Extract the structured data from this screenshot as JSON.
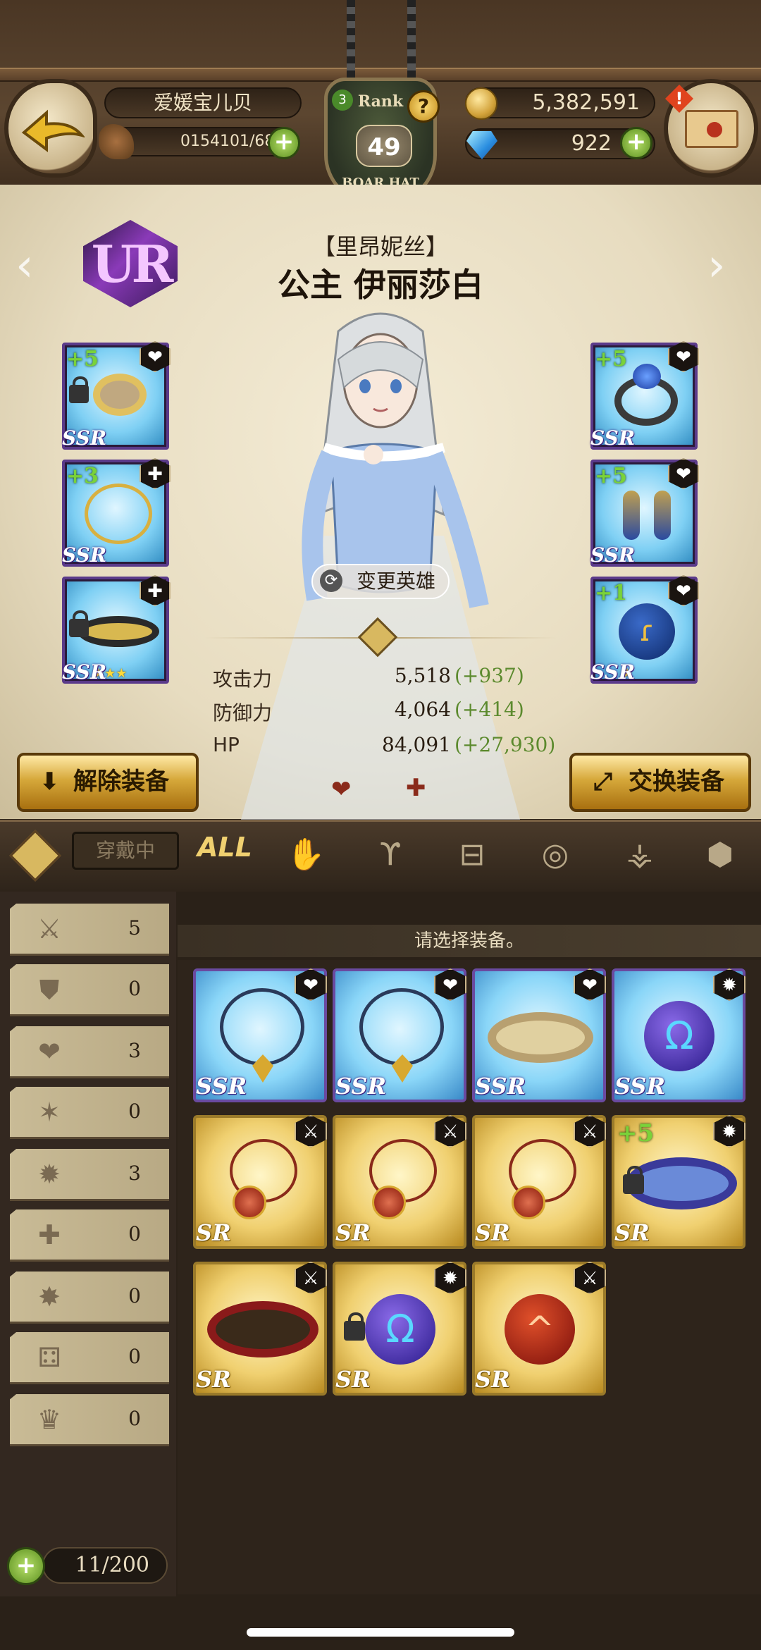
{
  "header": {
    "player_name": "爱媛宝儿贝",
    "stamina": "0154101/68",
    "rank_label": "Rank",
    "rank_level": "49",
    "rank_sub": "BOAR HAT",
    "rank_small": "3",
    "help": "?",
    "gold": "5,382,591",
    "gems": "922",
    "alert": "!"
  },
  "hero": {
    "rarity": "UR",
    "subtitle": "【里昂妮丝】",
    "name": "公主 伊丽莎白",
    "change_hero": "变更英雄"
  },
  "left_slots": [
    {
      "level": "+5",
      "rarity": "SSR",
      "category": "heart-icon",
      "locked": true
    },
    {
      "level": "+3",
      "rarity": "SSR",
      "category": "plus-icon",
      "locked": false
    },
    {
      "level": "",
      "rarity": "SSR",
      "category": "plus-icon",
      "locked": true,
      "stars": "★★★"
    }
  ],
  "right_slots": [
    {
      "level": "+5",
      "rarity": "SSR",
      "category": "heart-icon",
      "locked": false
    },
    {
      "level": "+5",
      "rarity": "SSR",
      "category": "heart-icon",
      "locked": false
    },
    {
      "level": "+1",
      "rarity": "SSR",
      "category": "heart-icon",
      "locked": false,
      "stars": "★"
    }
  ],
  "stats": [
    {
      "label": "攻击力",
      "value": "5,518",
      "bonus": "(+937)"
    },
    {
      "label": "防御力",
      "value": "4,064",
      "bonus": "(+414)"
    },
    {
      "label": "HP",
      "value": "84,091",
      "bonus": "(+27,930)"
    }
  ],
  "buttons": {
    "unequip": "解除装备",
    "swap": "交换装备",
    "heart": "❤",
    "plus": "✚"
  },
  "tabs": {
    "equipped": "穿戴中",
    "all": "ALL"
  },
  "filters": [
    {
      "icon": "sword-icon",
      "count": "5"
    },
    {
      "icon": "shield-icon",
      "count": "0"
    },
    {
      "icon": "heart-icon",
      "count": "3"
    },
    {
      "icon": "burst-icon",
      "count": "0"
    },
    {
      "icon": "sun-icon",
      "count": "3"
    },
    {
      "icon": "plus-icon",
      "count": "0"
    },
    {
      "icon": "star-burst-icon",
      "count": "0"
    },
    {
      "icon": "dice-icon",
      "count": "0"
    },
    {
      "icon": "crown-icon",
      "count": "0"
    }
  ],
  "inventory": {
    "header": "请选择装备。",
    "capacity": "11/200",
    "items": [
      {
        "rarity": "SSR",
        "kind": "necklace",
        "category": "heart-icon",
        "level": "",
        "locked": false
      },
      {
        "rarity": "SSR",
        "kind": "necklace",
        "category": "heart-icon",
        "level": "",
        "locked": false
      },
      {
        "rarity": "SSR",
        "kind": "bracelet",
        "category": "heart-icon",
        "level": "",
        "locked": false
      },
      {
        "rarity": "SSR",
        "kind": "orb-omega",
        "category": "sun-icon",
        "level": "",
        "locked": false
      },
      {
        "rarity": "SR",
        "kind": "pendant",
        "category": "sword-icon",
        "level": "",
        "locked": false
      },
      {
        "rarity": "SR",
        "kind": "pendant",
        "category": "sword-icon",
        "level": "",
        "locked": false
      },
      {
        "rarity": "SR",
        "kind": "pendant",
        "category": "sword-icon",
        "level": "",
        "locked": false
      },
      {
        "rarity": "SR",
        "kind": "belt-blue",
        "category": "sun-icon",
        "level": "+5",
        "locked": true
      },
      {
        "rarity": "SR",
        "kind": "belt-red",
        "category": "sword-icon",
        "level": "",
        "locked": false
      },
      {
        "rarity": "SR",
        "kind": "orb-omega",
        "category": "sun-icon",
        "level": "",
        "locked": true
      },
      {
        "rarity": "SR",
        "kind": "orb-red",
        "category": "sword-icon",
        "level": "",
        "locked": false
      }
    ]
  },
  "colors": {
    "panel_bg": "#ece3ca",
    "ssr_frame": "#6a4aa0",
    "sr_frame": "#9a7a2a",
    "bonus_green": "#5c8a2e",
    "gold_button": "#d6a83a"
  }
}
